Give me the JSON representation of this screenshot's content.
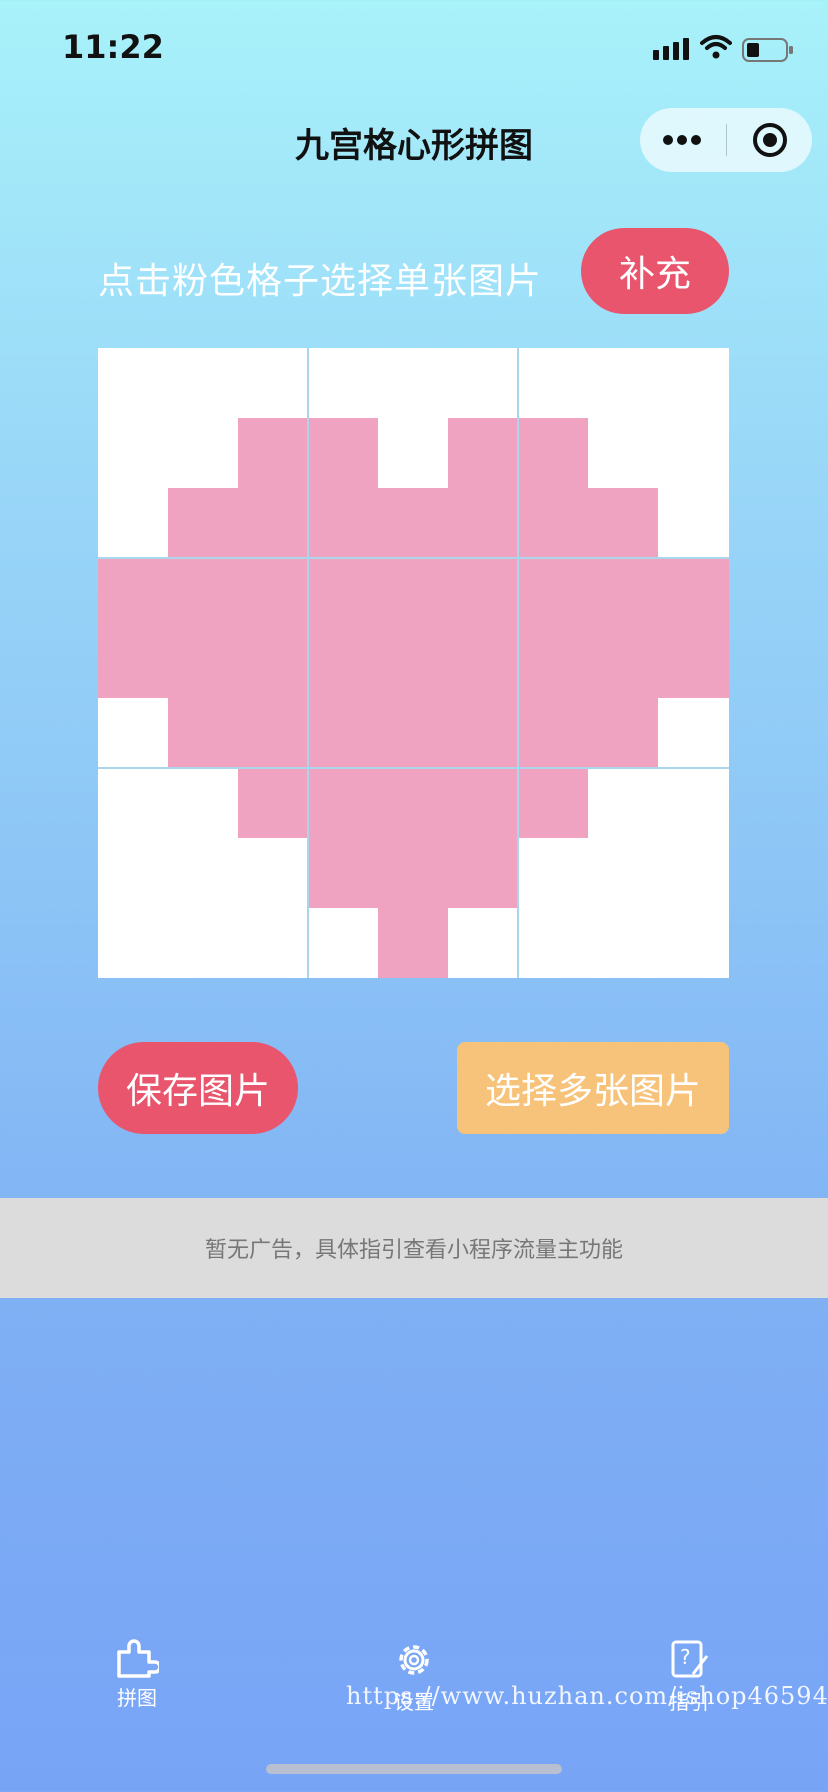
{
  "status_bar": {
    "time": "11:22"
  },
  "header": {
    "title": "九宫格心形拼图"
  },
  "hint": {
    "text": "点击粉色格子选择单张图片",
    "supplement_label": "补充"
  },
  "colors": {
    "accent_red": "#e8556c",
    "accent_orange": "#f7c37a",
    "heart_pink": "#f0a3c1"
  },
  "actions": {
    "save_label": "保存图片",
    "select_multi_label": "选择多张图片"
  },
  "ad": {
    "text": "暂无广告，具体指引查看小程序流量主功能"
  },
  "tabs": [
    {
      "label": "拼图",
      "icon": "puzzle-icon",
      "active": true
    },
    {
      "label": "设置",
      "icon": "gear-icon",
      "active": false
    },
    {
      "label": "指引",
      "icon": "guide-icon",
      "active": false
    }
  ],
  "watermark": "https://www.huzhan.com/ishop46594"
}
